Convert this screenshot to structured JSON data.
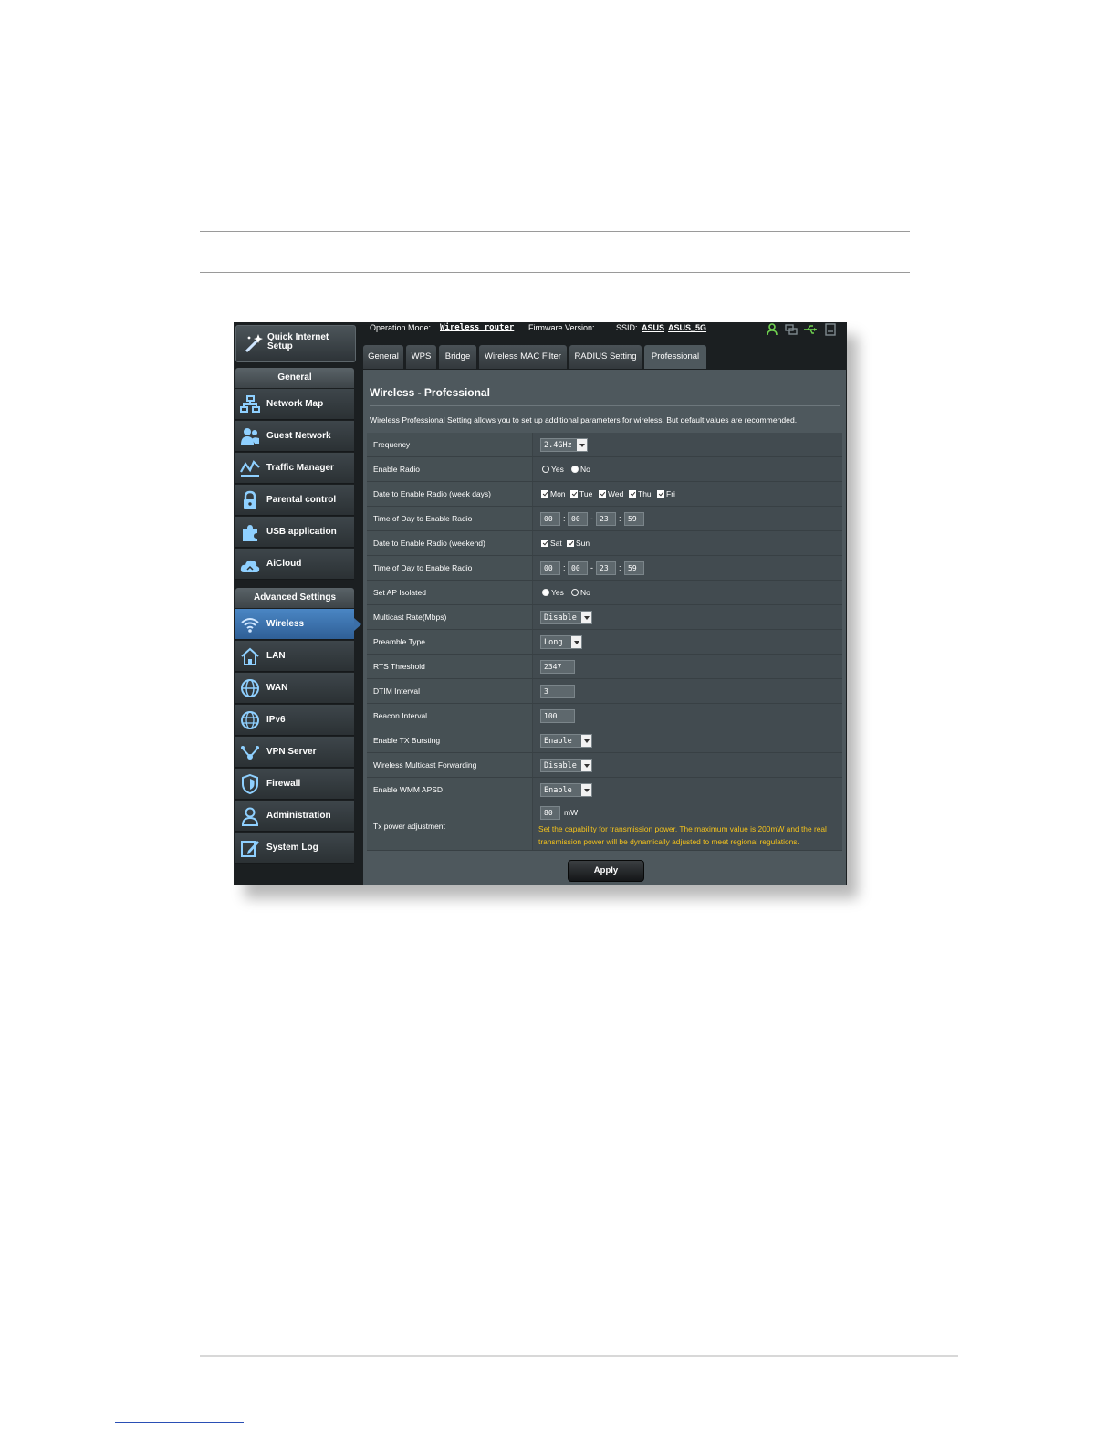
{
  "sidebar": {
    "quick_setup": "Quick Internet Setup",
    "general_header": "General",
    "general_items": [
      "Network Map",
      "Guest Network",
      "Traffic Manager",
      "Parental control",
      "USB application",
      "AiCloud"
    ],
    "advanced_header": "Advanced Settings",
    "advanced_items": [
      "Wireless",
      "LAN",
      "WAN",
      "IPv6",
      "VPN Server",
      "Firewall",
      "Administration",
      "System Log"
    ],
    "active_item": "Wireless"
  },
  "header": {
    "operation_mode_label": "Operation Mode:",
    "operation_mode_value": "Wireless router",
    "firmware_label": "Firmware Version:",
    "ssid_label": "SSID:",
    "ssid_values": [
      "ASUS",
      "ASUS_5G"
    ]
  },
  "tabs": [
    "General",
    "WPS",
    "Bridge",
    "Wireless MAC Filter",
    "RADIUS Setting",
    "Professional"
  ],
  "active_tab": "Professional",
  "panel": {
    "title": "Wireless - Professional",
    "description": "Wireless Professional Setting allows you to set up additional parameters for wireless. But default values are recommended."
  },
  "rows": {
    "frequency": {
      "label": "Frequency",
      "value": "2.4GHz"
    },
    "enable_radio": {
      "label": "Enable Radio",
      "options": [
        "Yes",
        "No"
      ],
      "selected": "No"
    },
    "weekdays": {
      "label": "Date to Enable Radio (week days)",
      "options": [
        "Mon",
        "Tue",
        "Wed",
        "Thu",
        "Fri"
      ]
    },
    "weekday_time": {
      "label": "Time of Day to Enable Radio",
      "values": [
        "00",
        "00",
        "23",
        "59"
      ]
    },
    "weekend": {
      "label": "Date to Enable Radio (weekend)",
      "options": [
        "Sat",
        "Sun"
      ]
    },
    "weekend_time": {
      "label": "Time of Day to Enable Radio",
      "values": [
        "00",
        "00",
        "23",
        "59"
      ]
    },
    "ap_isolated": {
      "label": "Set AP Isolated",
      "options": [
        "Yes",
        "No"
      ],
      "selected": "Yes"
    },
    "multicast_rate": {
      "label": "Multicast Rate(Mbps)",
      "value": "Disable"
    },
    "preamble": {
      "label": "Preamble Type",
      "value": "Long"
    },
    "rts": {
      "label": "RTS Threshold",
      "value": "2347"
    },
    "dtim": {
      "label": "DTIM Interval",
      "value": "3"
    },
    "beacon": {
      "label": "Beacon Interval",
      "value": "100"
    },
    "tx_bursting": {
      "label": "Enable TX Bursting",
      "value": "Enable"
    },
    "multicast_fwd": {
      "label": "Wireless Multicast Forwarding",
      "value": "Disable"
    },
    "wmm_apsd": {
      "label": "Enable WMM APSD",
      "value": "Enable"
    },
    "tx_power": {
      "label": "Tx power adjustment",
      "value": "80",
      "unit": "mW",
      "note": "Set the capability for transmission power. The maximum value is 200mW and the real transmission power will be dynamically adjusted to meet regional regulations."
    }
  },
  "apply_label": "Apply",
  "colors": {
    "note": "#f4c21b",
    "active_nav": "#3b6fa8",
    "panel": "#4e585d"
  }
}
